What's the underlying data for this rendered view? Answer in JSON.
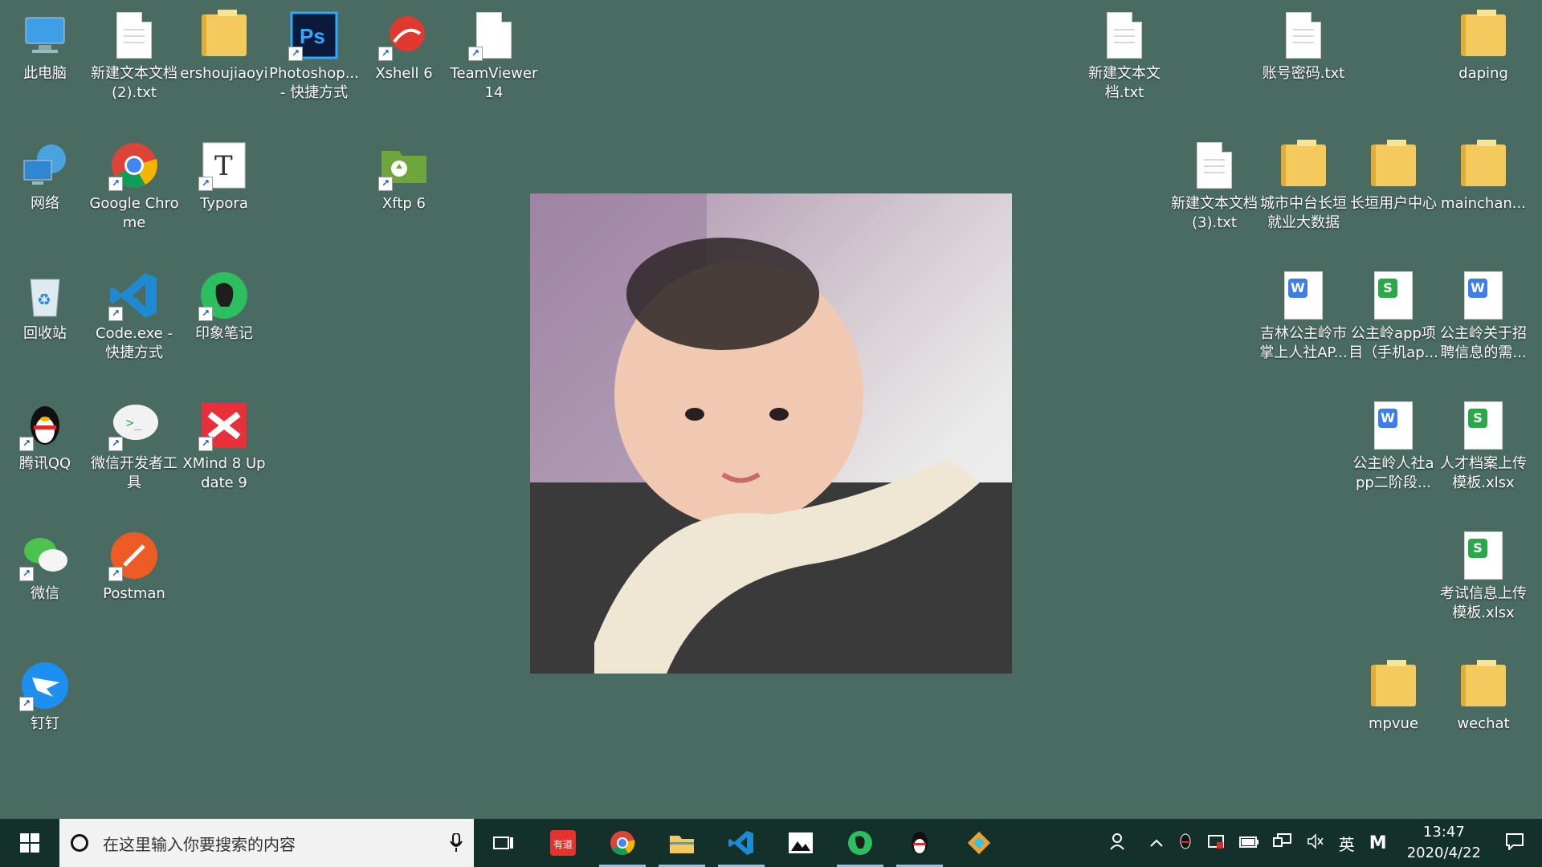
{
  "desktop": {
    "icons": [
      {
        "label": "此电脑",
        "kind": "computer",
        "shortcut": false
      },
      {
        "label": "新建文本文档 (2).txt",
        "kind": "file",
        "shortcut": false
      },
      {
        "label": "ershoujiaoyi",
        "kind": "folder",
        "shortcut": false
      },
      {
        "label": "Photoshop... - 快捷方式",
        "kind": "photoshop",
        "shortcut": true
      },
      {
        "label": "Xshell 6",
        "kind": "xshell",
        "shortcut": true
      },
      {
        "label": "TeamViewer 14",
        "kind": "file",
        "shortcut": true
      },
      {
        "label": "新建文本文档.txt",
        "kind": "file",
        "shortcut": false
      },
      {
        "label": "账号密码.txt",
        "kind": "file",
        "shortcut": false
      },
      {
        "label": "daping",
        "kind": "folder",
        "shortcut": false
      },
      {
        "label": "网络",
        "kind": "network",
        "shortcut": false
      },
      {
        "label": "Google Chrome",
        "kind": "chrome",
        "shortcut": true
      },
      {
        "label": "Typora",
        "kind": "typora",
        "shortcut": true
      },
      {
        "label": "Xftp 6",
        "kind": "xftp",
        "shortcut": true
      },
      {
        "label": "新建文本文档 (3).txt",
        "kind": "file",
        "shortcut": false
      },
      {
        "label": "城市中台长垣就业大数据",
        "kind": "folder",
        "shortcut": false
      },
      {
        "label": "长垣用户中心",
        "kind": "folder",
        "shortcut": false
      },
      {
        "label": "mainchan...",
        "kind": "folder",
        "shortcut": false
      },
      {
        "label": "回收站",
        "kind": "recycle",
        "shortcut": false
      },
      {
        "label": "Code.exe - 快捷方式",
        "kind": "vscode",
        "shortcut": true
      },
      {
        "label": "印象笔记",
        "kind": "evernote",
        "shortcut": true
      },
      {
        "label": "吉林公主岭市掌上人社AP...",
        "kind": "word",
        "shortcut": false
      },
      {
        "label": "公主岭app项目（手机ap...",
        "kind": "sheet",
        "shortcut": false
      },
      {
        "label": "公主岭关于招聘信息的需...",
        "kind": "word",
        "shortcut": false
      },
      {
        "label": "腾讯QQ",
        "kind": "qq",
        "shortcut": true
      },
      {
        "label": "微信开发者工具",
        "kind": "wxdev",
        "shortcut": true
      },
      {
        "label": "XMind 8 Update 9",
        "kind": "xmind",
        "shortcut": true
      },
      {
        "label": "公主岭人社app二阶段...",
        "kind": "word",
        "shortcut": false
      },
      {
        "label": "人才档案上传模板.xlsx",
        "kind": "sheet",
        "shortcut": false
      },
      {
        "label": "微信",
        "kind": "wechat",
        "shortcut": true
      },
      {
        "label": "Postman",
        "kind": "postman",
        "shortcut": true
      },
      {
        "label": "考试信息上传模板.xlsx",
        "kind": "sheet",
        "shortcut": false
      },
      {
        "label": "钉钉",
        "kind": "dingtalk",
        "shortcut": true
      },
      {
        "label": "mpvue",
        "kind": "folder",
        "shortcut": false
      },
      {
        "label": "wechat",
        "kind": "folder",
        "shortcut": false
      }
    ]
  },
  "taskbar": {
    "search_placeholder": "在这里输入你要搜索的内容",
    "apps": [
      "youdao",
      "chrome",
      "explorer",
      "vscode",
      "photos",
      "evernote",
      "qq",
      "git"
    ],
    "ime_label": "英",
    "m_label": "M",
    "time": "13:47",
    "date": "2020/4/22"
  }
}
